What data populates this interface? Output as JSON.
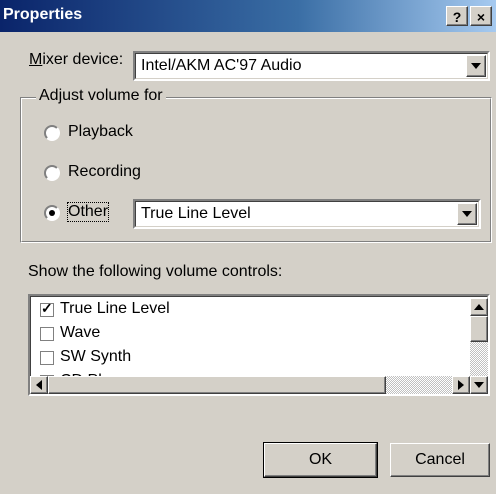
{
  "window": {
    "title": "Properties",
    "help_label": "?",
    "close_label": "×"
  },
  "mixer": {
    "label": "Mixer device:",
    "value": "Intel/AKM AC'97 Audio"
  },
  "adjust_group": {
    "legend": "Adjust volume for",
    "options": [
      {
        "label": "Playback",
        "selected": false
      },
      {
        "label": "Recording",
        "selected": false
      },
      {
        "label": "Other",
        "selected": true
      }
    ],
    "other_value": "True Line Level"
  },
  "controls": {
    "label": "Show the following volume controls:",
    "items": [
      {
        "label": "True Line Level",
        "checked": true
      },
      {
        "label": "Wave",
        "checked": false
      },
      {
        "label": "SW Synth",
        "checked": false
      },
      {
        "label": "CD Player",
        "checked": false
      }
    ]
  },
  "buttons": {
    "ok": "OK",
    "cancel": "Cancel"
  }
}
